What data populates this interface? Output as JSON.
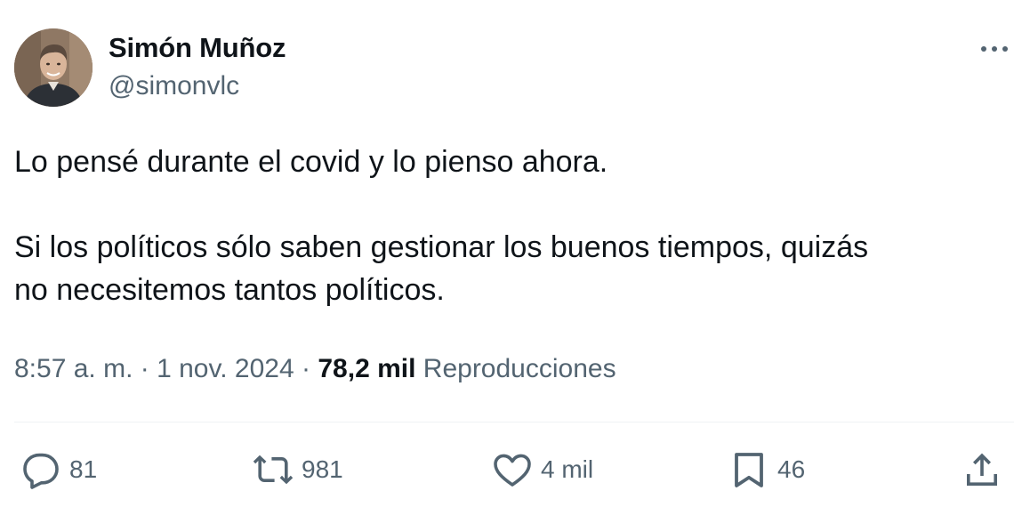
{
  "author": {
    "name": "Simón Muñoz",
    "handle": "@simonvlc"
  },
  "tweet": {
    "paragraphs": [
      "Lo pensé durante el covid y lo pienso ahora.",
      "Si los políticos sólo saben gestionar los buenos tiempos, quizás",
      "no necesitemos tantos políticos."
    ],
    "time": "8:57 a. m.",
    "separator": "·",
    "date": "1 nov. 2024",
    "views_count": "78,2 mil",
    "views_label": "Reproducciones"
  },
  "actions": {
    "replies": "81",
    "retweets": "981",
    "likes": "4 mil",
    "bookmarks": "46"
  },
  "icons": {
    "more": "more-dots-icon",
    "reply": "reply-bubble-icon",
    "retweet": "retweet-icon",
    "like": "heart-icon",
    "bookmark": "bookmark-icon",
    "share": "share-upload-icon"
  },
  "colors": {
    "text_primary": "#0f1419",
    "text_secondary": "#536471",
    "divider": "#eff3f4"
  }
}
